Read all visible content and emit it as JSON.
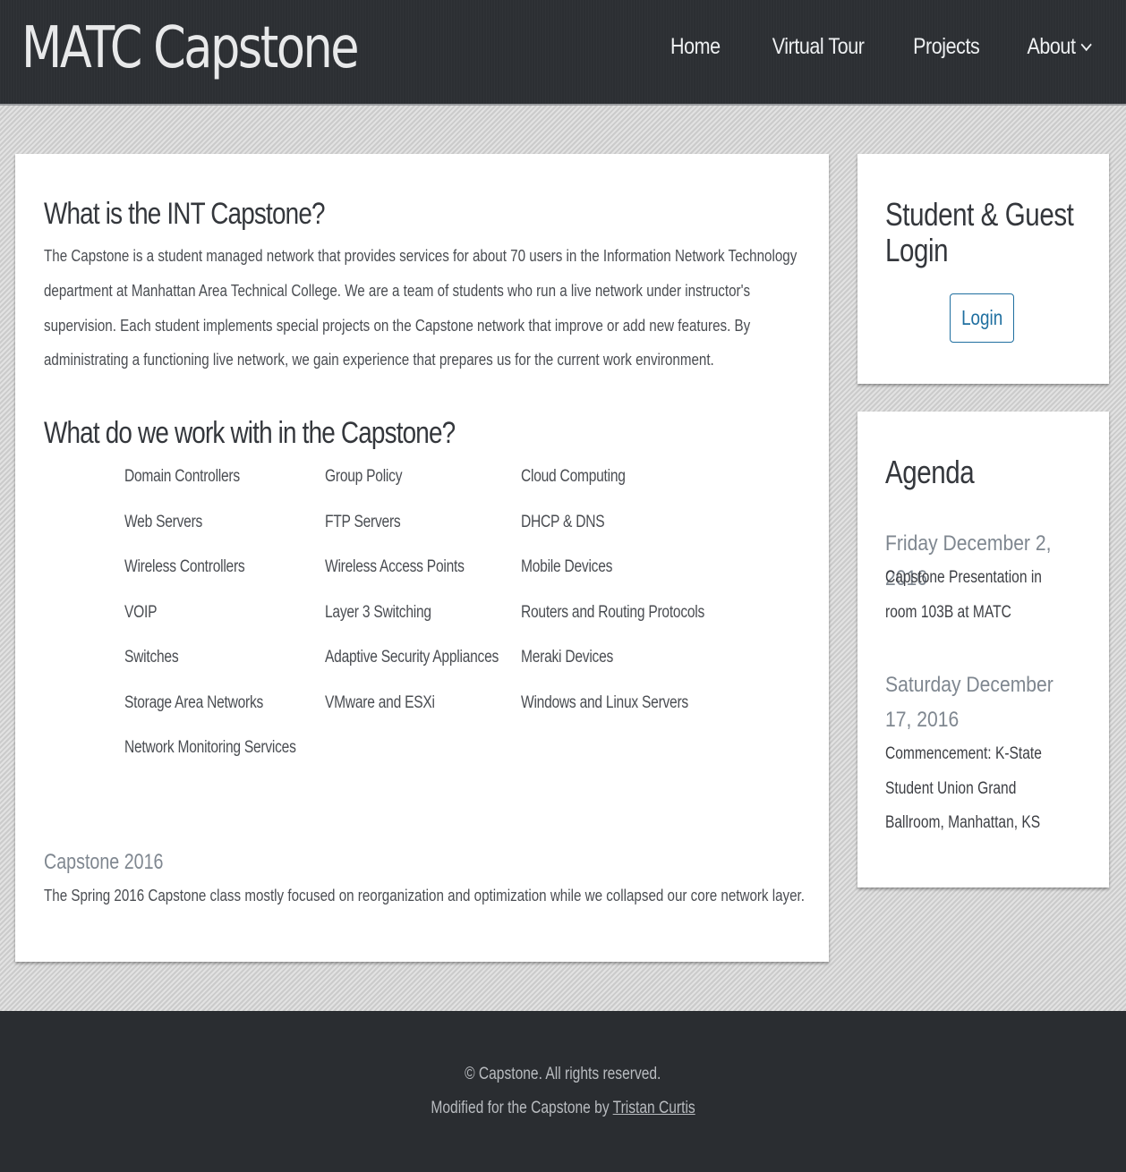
{
  "header": {
    "logo": "MATC Capstone",
    "nav": {
      "home": "Home",
      "virtual_tour": "Virtual Tour",
      "projects": "Projects",
      "about": "About"
    }
  },
  "main": {
    "intro_title": "What is the INT Capstone?",
    "intro_text": "The Capstone is a student managed network that provides services for about 70 users in the Information Network Technology department at Manhattan Area Technical College. We are a team of students who run a live network under instructor's supervision. Each student implements special projects on the Capstone network that improve or add new features. By administrating a functioning live network, we gain experience that prepares us for the current work environment.",
    "work_title": "What do we work with in the Capstone?",
    "tech_columns": [
      [
        "Domain Controllers",
        "Web Servers",
        "Wireless Controllers",
        "VOIP",
        "Switches",
        "Storage Area Networks",
        "Network Monitoring Services"
      ],
      [
        "Group Policy",
        "FTP Servers",
        "Wireless Access Points",
        "Layer 3 Switching",
        "Adaptive Security Appliances",
        "VMware and ESXi"
      ],
      [
        "Cloud Computing",
        "DHCP & DNS",
        "Mobile Devices",
        "Routers and Routing Protocols",
        "Meraki Devices",
        "Windows and Linux Servers"
      ]
    ],
    "capstone_year_title": "Capstone 2016",
    "capstone_year_text": "The Spring 2016 Capstone class mostly focused on reorganization and optimization while we collapsed our core network layer."
  },
  "login_panel": {
    "title": "Student & Guest Login",
    "button": "Login"
  },
  "agenda": {
    "title": "Agenda",
    "events": [
      {
        "date": "Friday December 2, 2016",
        "desc": "Capstone Presentation in room 103B at MATC"
      },
      {
        "date": "Saturday December 17, 2016",
        "desc": "Commencement: K-State Student Union Grand Ballroom, Manhattan, KS"
      }
    ]
  },
  "footer": {
    "copyright": "© Capstone. All rights reserved.",
    "modified_prefix": "Modified for the Capstone by ",
    "author_link": "Tristan Curtis"
  }
}
